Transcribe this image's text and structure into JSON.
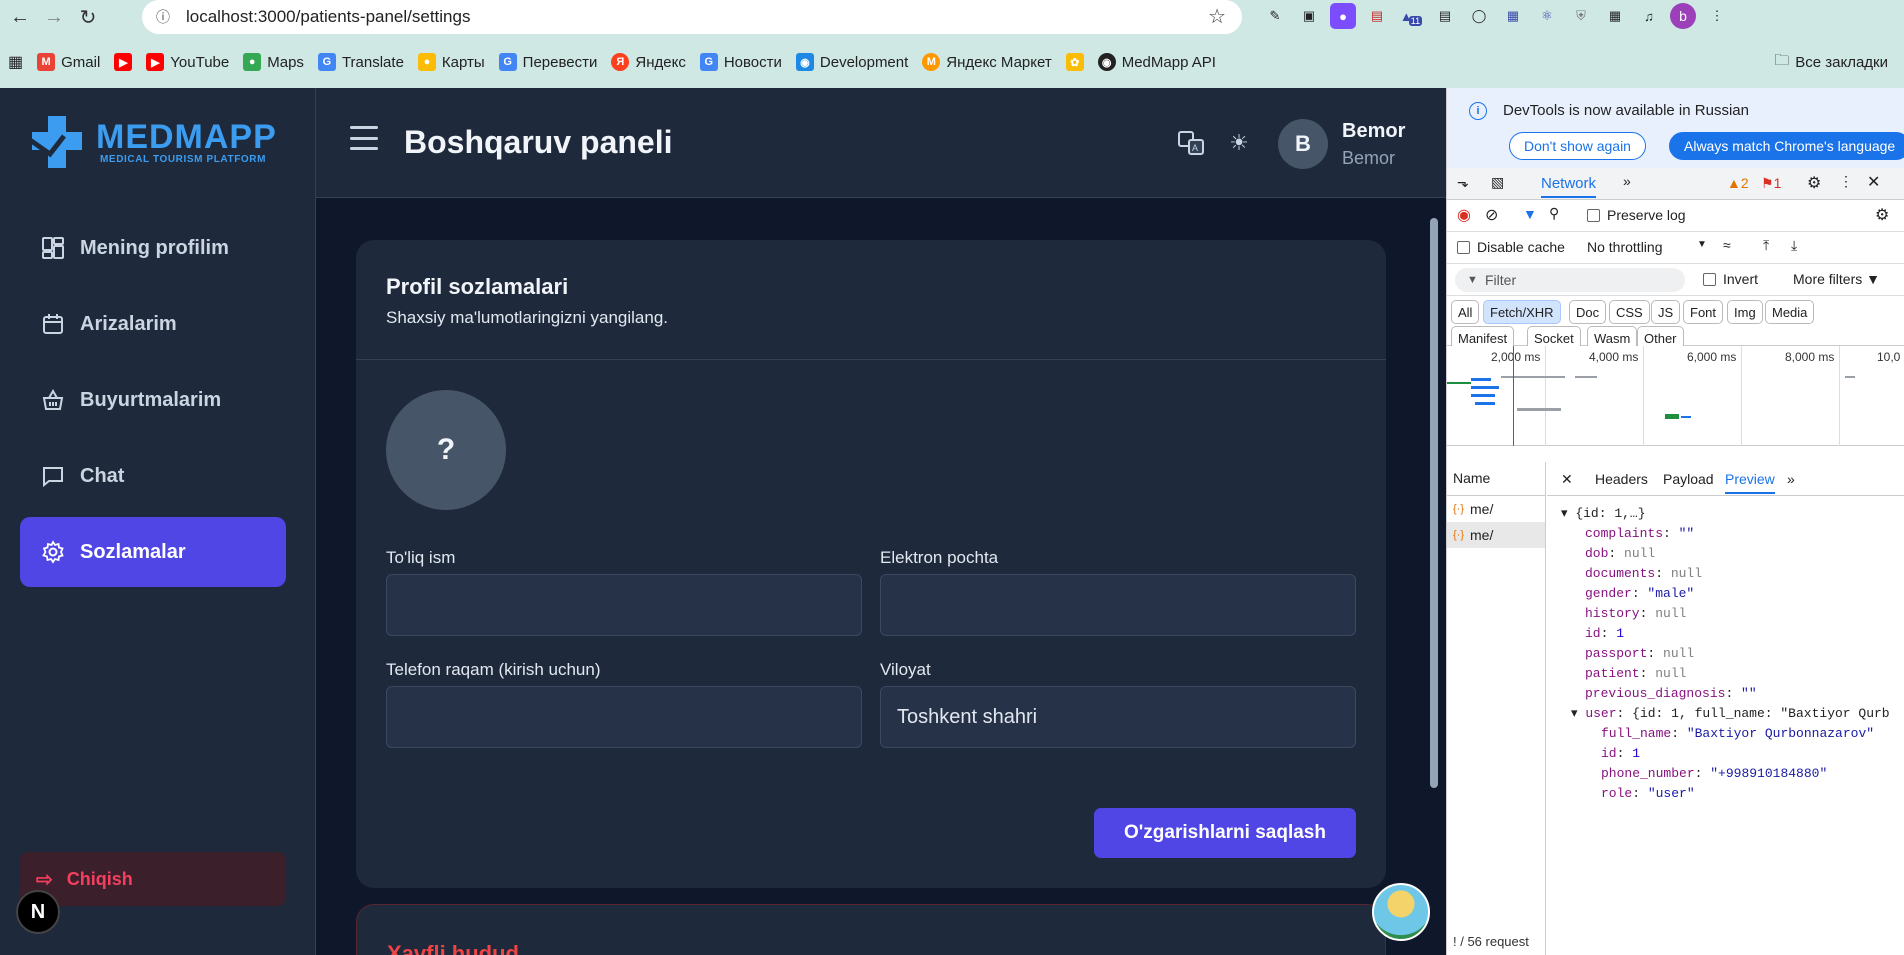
{
  "browser": {
    "url": "localhost:3000/patients-panel/settings",
    "bookmarks": [
      "Gmail",
      "YouTube",
      "Maps",
      "Translate",
      "Карты",
      "Перевести",
      "Яндекс",
      "Новости",
      "Development",
      "Яндекс Маркет",
      "",
      "MedMapp API"
    ],
    "all_bookmarks": "Все закладки",
    "extension_badge": "11",
    "profile_initial": "b"
  },
  "app": {
    "logo_title": "MEDMAPP",
    "logo_sub": "MEDICAL TOURISM PLATFORM",
    "menu": [
      {
        "label": "Mening profilim",
        "icon": "dashboard-icon"
      },
      {
        "label": "Arizalarim",
        "icon": "calendar-icon"
      },
      {
        "label": "Buyurtmalarim",
        "icon": "basket-icon"
      },
      {
        "label": "Chat",
        "icon": "chat-icon"
      },
      {
        "label": "Sozlamalar",
        "icon": "gear-icon"
      }
    ],
    "logout": "Chiqish",
    "next_badge": "N",
    "page_title": "Boshqaruv paneli",
    "user_initial": "B",
    "user_name": "Bemor",
    "user_role": "Bemor",
    "card": {
      "title": "Profil sozlamalari",
      "subtitle": "Shaxsiy ma'lumotlaringizni yangilang.",
      "photo_placeholder": "?",
      "fields": {
        "full_name_label": "To'liq ism",
        "full_name_value": "",
        "email_label": "Elektron pochta",
        "email_value": "",
        "phone_label": "Telefon raqam (kirish uchun)",
        "phone_value": "",
        "region_label": "Viloyat",
        "region_value": "Toshkent shahri"
      },
      "save_label": "O'zgarishlarni saqlash"
    },
    "danger_title": "Xavfli hudud"
  },
  "devtools": {
    "banner": "DevTools is now available in Russian",
    "dont_show": "Don't show again",
    "always_match": "Always match Chrome's language",
    "tab_network": "Network",
    "warnings": "2",
    "errors": "1",
    "preserve_log": "Preserve log",
    "disable_cache": "Disable cache",
    "throttling": "No throttling",
    "filter_placeholder": "Filter",
    "invert": "Invert",
    "more_filters": "More filters",
    "chips_row1": [
      "All",
      "Fetch/XHR",
      "Doc",
      "CSS",
      "JS",
      "Font",
      "Img",
      "Media"
    ],
    "chips_row2": [
      "Manifest",
      "Socket",
      "Wasm",
      "Other"
    ],
    "timeline_labels": [
      "2,000 ms",
      "4,000 ms",
      "6,000 ms",
      "8,000 ms",
      "10,0"
    ],
    "name_header": "Name",
    "requests": [
      "me/",
      "me/"
    ],
    "preview_tabs": [
      "Headers",
      "Payload",
      "Preview"
    ],
    "status": "! / 56 request",
    "json_lines": {
      "root": "{id: 1,…}",
      "complaints_k": "complaints",
      "complaints_v": "\"\"",
      "dob_k": "dob",
      "dob_v": "null",
      "documents_k": "documents",
      "documents_v": "null",
      "gender_k": "gender",
      "gender_v": "\"male\"",
      "history_k": "history",
      "history_v": "null",
      "id_k": "id",
      "id_v": "1",
      "passport_k": "passport",
      "passport_v": "null",
      "patient_k": "patient",
      "patient_v": "null",
      "prev_k": "previous_diagnosis",
      "prev_v": "\"\"",
      "user_k": "user",
      "user_v": "{id: 1, full_name: \"Baxtiyor Qurb",
      "full_name_k": "full_name",
      "full_name_v": "\"Baxtiyor Qurbonnazarov\"",
      "uid_k": "id",
      "uid_v": "1",
      "phone_k": "phone_number",
      "phone_v": "\"+998910184880\"",
      "role_k": "role",
      "role_v": "\"user\""
    }
  }
}
